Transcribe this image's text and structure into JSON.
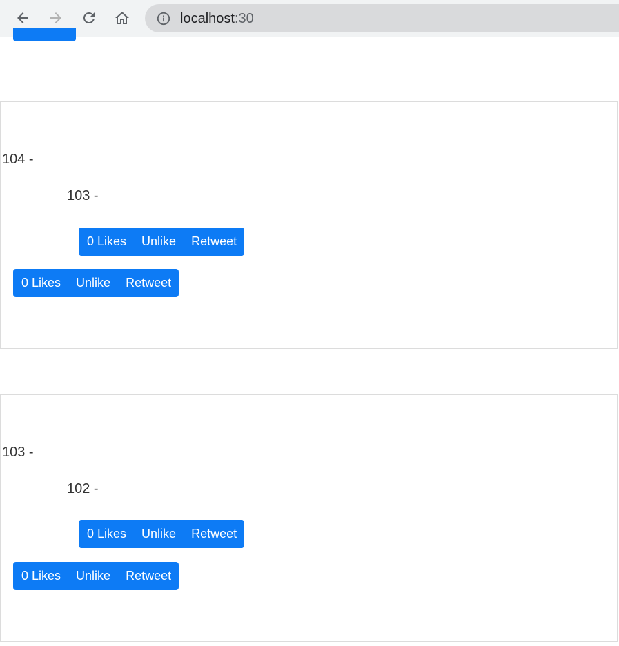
{
  "browser": {
    "url_host": "localhost",
    "url_port": ":30"
  },
  "tweets": [
    {
      "parent_text": "104 -",
      "reply_text": "103 -",
      "reply_buttons": {
        "likes": "0 Likes",
        "unlike": "Unlike",
        "retweet": "Retweet"
      },
      "buttons": {
        "likes": "0 Likes",
        "unlike": "Unlike",
        "retweet": "Retweet"
      }
    },
    {
      "parent_text": "103 -",
      "reply_text": "102 -",
      "reply_buttons": {
        "likes": "0 Likes",
        "unlike": "Unlike",
        "retweet": "Retweet"
      },
      "buttons": {
        "likes": "0 Likes",
        "unlike": "Unlike",
        "retweet": "Retweet"
      }
    }
  ],
  "colors": {
    "accent": "#0d7bf5",
    "toolbar": "#f1f3f4",
    "omnibox": "#d9dadc"
  }
}
